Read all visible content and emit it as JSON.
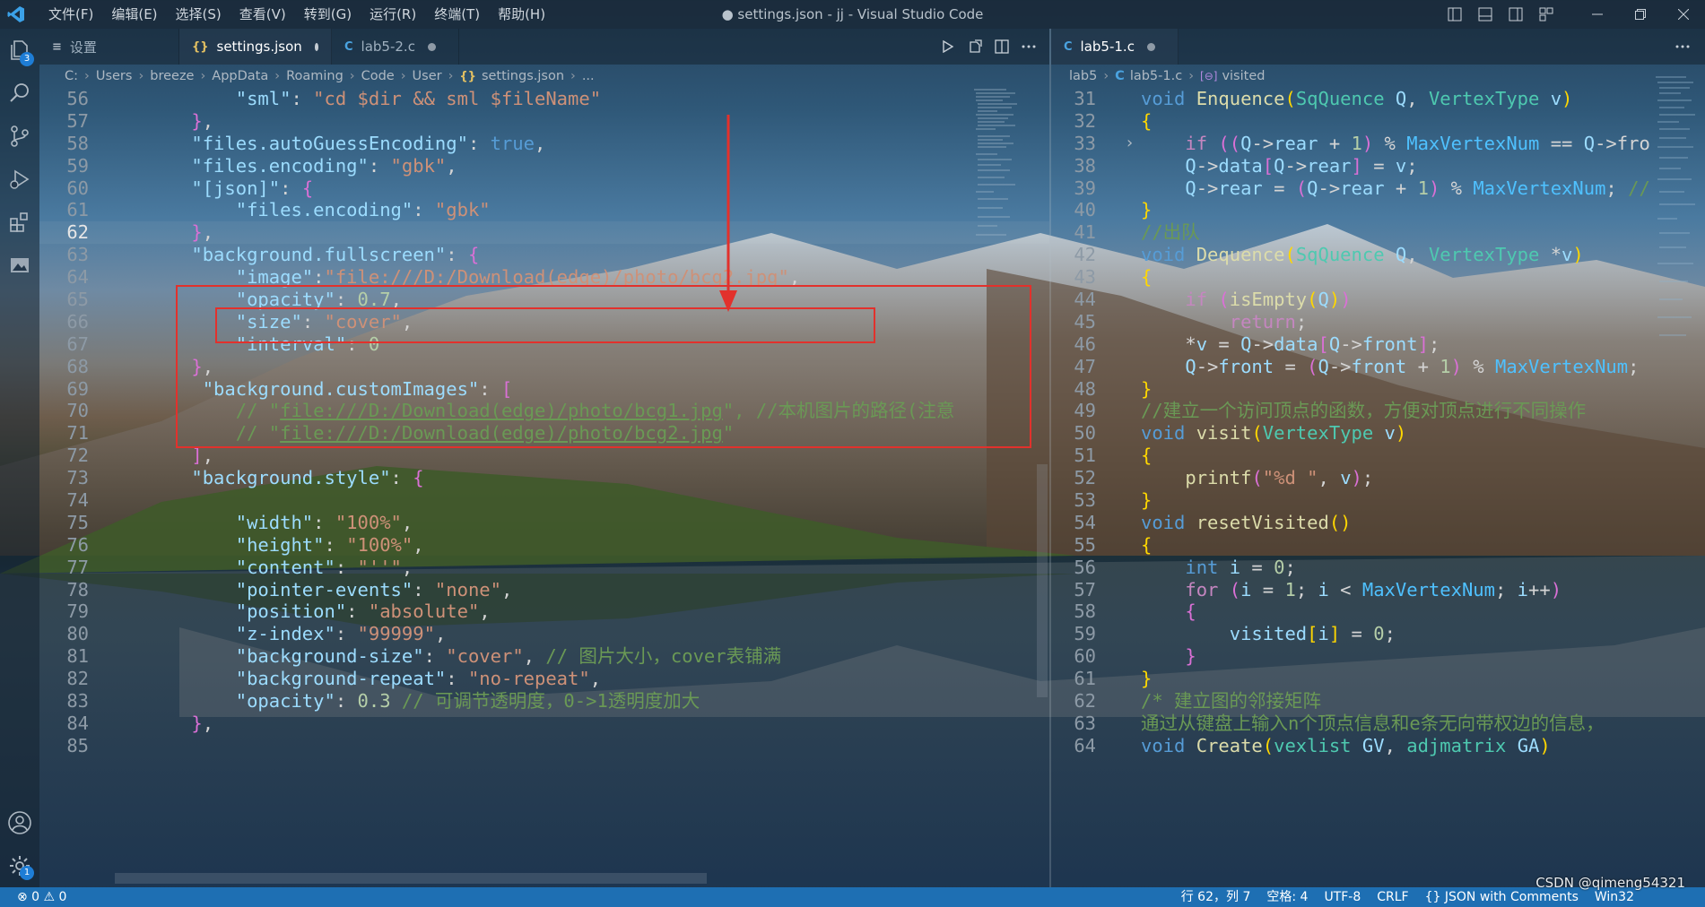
{
  "window": {
    "title": "● settings.json - jj - Visual Studio Code",
    "menu": [
      "文件(F)",
      "编辑(E)",
      "选择(S)",
      "查看(V)",
      "转到(G)",
      "运行(R)",
      "终端(T)",
      "帮助(H)"
    ]
  },
  "activity_bar": {
    "explorer_badge": "3",
    "settings_badge": "1"
  },
  "left_editor": {
    "tabs": [
      {
        "icon": "≡",
        "label": "设置",
        "dirty": false
      },
      {
        "icon": "{}",
        "label": "settings.json",
        "dirty": true
      },
      {
        "icon": "C",
        "label": "lab5-2.c",
        "dirty": true
      }
    ],
    "breadcrumb": [
      "C:",
      "Users",
      "breeze",
      "AppData",
      "Roaming",
      "Code",
      "User",
      "settings.json",
      "..."
    ],
    "line_numbers": [
      "56",
      "57",
      "58",
      "59",
      "60",
      "61",
      "62",
      "63",
      "64",
      "65",
      "66",
      "67",
      "68",
      "69",
      "70",
      "71",
      "72",
      "73",
      "74",
      "75",
      "76",
      "77",
      "78",
      "79",
      "80",
      "81",
      "82",
      "83",
      "84",
      "85"
    ],
    "current_line": "62"
  },
  "right_editor": {
    "tab": {
      "icon": "C",
      "label": "lab5-1.c",
      "dirty": true
    },
    "breadcrumb": [
      "lab5",
      "lab5-1.c",
      "visited"
    ],
    "line_numbers": [
      "31",
      "32",
      "33",
      "38",
      "39",
      "40",
      "41",
      "42",
      "43",
      "44",
      "45",
      "46",
      "47",
      "48",
      "49",
      "50",
      "51",
      "52",
      "53",
      "54",
      "55",
      "56",
      "57",
      "58",
      "59",
      "60",
      "61",
      "62",
      "63",
      "64"
    ]
  },
  "status_bar": {
    "problems": "⊗ 0 ⚠ 0",
    "position": "行 62，列 7",
    "spaces": "空格: 4",
    "encoding": "UTF-8",
    "eol": "CRLF",
    "language": "{} JSON with Comments",
    "platform": "Win32"
  },
  "watermark": "CSDN @qimeng54321",
  "colors": {
    "status_bar": "#1e6fb3",
    "annotation": "#e2312c"
  }
}
